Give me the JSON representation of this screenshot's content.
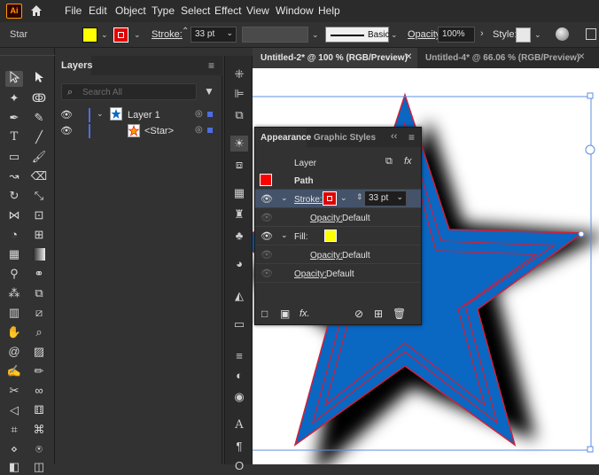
{
  "app": {
    "logo": "Ai"
  },
  "menu": [
    "File",
    "Edit",
    "Object",
    "Type",
    "Select",
    "Effect",
    "View",
    "Window",
    "Help"
  ],
  "control": {
    "object_type": "Star",
    "fill_color": "#ffff00",
    "stroke_color": "#e00000",
    "stroke_label": "Stroke:",
    "stroke_weight": "33 pt",
    "brush": "Basic",
    "opacity_label": "Opacity:",
    "opacity_value": "100%",
    "style_label": "Style:"
  },
  "layers": {
    "tab": "Layers",
    "search_placeholder": "Search All",
    "rows": [
      {
        "name": "Layer 1"
      },
      {
        "name": "<Star>"
      }
    ]
  },
  "doc_tabs": [
    {
      "label": "Untitled-2* @ 100 % (RGB/Preview)",
      "active": true
    },
    {
      "label": "Untitled-4* @ 66.06 % (RGB/Preview)",
      "active": false
    }
  ],
  "appearance": {
    "tabs": [
      "Appearance",
      "Graphic Styles"
    ],
    "layer_label": "Layer",
    "path_label": "Path",
    "stroke_label": "Stroke:",
    "stroke_weight": "33 pt",
    "opacity_label": "Opacity:",
    "opacity_value": "Default",
    "fill_label": "Fill:",
    "fill_color": "#ffff00",
    "stroke_color": "#e00000",
    "path_color": "#ff0000"
  },
  "canvas": {
    "star_color": "#0a67c2",
    "star_stroke": "#d0203a"
  }
}
